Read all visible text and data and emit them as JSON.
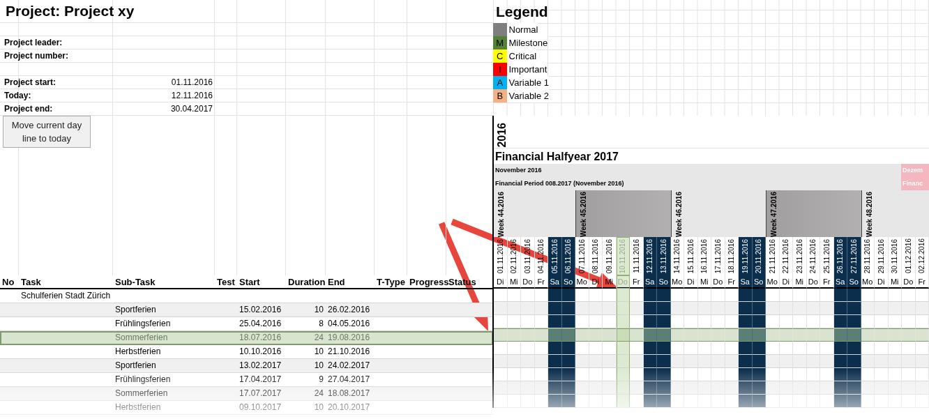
{
  "project": {
    "title": "Project: Project xy",
    "people": [
      "Project leader:",
      "Project number:"
    ],
    "dates": [
      {
        "label": "Project start:",
        "value": "01.11.2016"
      },
      {
        "label": "Today:",
        "value": "12.11.2016"
      },
      {
        "label": "Project end:",
        "value": "30.04.2017"
      }
    ],
    "action_button": "Move current day line to today"
  },
  "legend": {
    "title": "Legend",
    "items": [
      {
        "label": "Normal",
        "color": "#7f7f7f"
      },
      {
        "letter": "M",
        "label": "Milestone",
        "color": "#548235"
      },
      {
        "letter": "C",
        "label": "Critical",
        "color": "#ffff00"
      },
      {
        "letter": "I",
        "label": "Important",
        "color": "#ff0000"
      },
      {
        "letter": "A",
        "label": "Variable 1",
        "color": "#00b0f0"
      },
      {
        "letter": "B",
        "label": "Variable 2",
        "color": "#f4b183"
      }
    ]
  },
  "gantt": {
    "year": "2016",
    "title": "Financial Halfyear 2017",
    "month": "November 2016",
    "period": "Financial Period 008.2017 (November 2016)",
    "next_month": "Dezem",
    "next_period": "Financ",
    "weeks": [
      {
        "label": "Week 44.2016",
        "shaded": false,
        "days": [
          {
            "date": "01.11.2016",
            "weekday": "Di",
            "kind": "workday",
            "selected": false
          },
          {
            "date": "02.11.2016",
            "weekday": "Mi",
            "kind": "workday",
            "selected": false
          },
          {
            "date": "03.11.2016",
            "weekday": "Do",
            "kind": "workday",
            "selected": false
          },
          {
            "date": "04.11.2016",
            "weekday": "Fr",
            "kind": "workday",
            "selected": false
          },
          {
            "date": "05.11.2016",
            "weekday": "Sa",
            "kind": "weekend",
            "selected": false
          },
          {
            "date": "06.11.2016",
            "weekday": "So",
            "kind": "weekend",
            "selected": false
          }
        ]
      },
      {
        "label": "Week 45.2016",
        "shaded": true,
        "days": [
          {
            "date": "07.11.2016",
            "weekday": "Mo",
            "kind": "workday",
            "selected": false
          },
          {
            "date": "08.11.2016",
            "weekday": "Di",
            "kind": "workday",
            "selected": false
          },
          {
            "date": "09.11.2016",
            "weekday": "Mi",
            "kind": "workday",
            "selected": false
          },
          {
            "date": "10.11.2016",
            "weekday": "Do",
            "kind": "workday",
            "selected": true
          },
          {
            "date": "11.11.2016",
            "weekday": "Fr",
            "kind": "workday",
            "selected": false
          },
          {
            "date": "12.11.2016",
            "weekday": "Sa",
            "kind": "weekend",
            "selected": false
          },
          {
            "date": "13.11.2016",
            "weekday": "So",
            "kind": "weekend",
            "selected": false
          }
        ]
      },
      {
        "label": "Week 46.2016",
        "shaded": false,
        "days": [
          {
            "date": "14.11.2016",
            "weekday": "Mo",
            "kind": "workday",
            "selected": false
          },
          {
            "date": "15.11.2016",
            "weekday": "Di",
            "kind": "workday",
            "selected": false
          },
          {
            "date": "16.11.2016",
            "weekday": "Mi",
            "kind": "workday",
            "selected": false
          },
          {
            "date": "17.11.2016",
            "weekday": "Do",
            "kind": "workday",
            "selected": false
          },
          {
            "date": "18.11.2016",
            "weekday": "Fr",
            "kind": "workday",
            "selected": false
          },
          {
            "date": "19.11.2016",
            "weekday": "Sa",
            "kind": "weekend",
            "selected": false
          },
          {
            "date": "20.11.2016",
            "weekday": "So",
            "kind": "weekend",
            "selected": false
          }
        ]
      },
      {
        "label": "Week 47.2016",
        "shaded": true,
        "days": [
          {
            "date": "21.11.2016",
            "weekday": "Mo",
            "kind": "workday",
            "selected": false
          },
          {
            "date": "22.11.2016",
            "weekday": "Di",
            "kind": "workday",
            "selected": false
          },
          {
            "date": "23.11.2016",
            "weekday": "Mi",
            "kind": "workday",
            "selected": false
          },
          {
            "date": "24.11.2016",
            "weekday": "Do",
            "kind": "workday",
            "selected": false
          },
          {
            "date": "25.11.2016",
            "weekday": "Fr",
            "kind": "workday",
            "selected": false
          },
          {
            "date": "26.11.2016",
            "weekday": "Sa",
            "kind": "weekend",
            "selected": false
          },
          {
            "date": "27.11.2016",
            "weekday": "So",
            "kind": "weekend",
            "selected": false
          }
        ]
      },
      {
        "label": "Week 48.2016",
        "shaded": false,
        "days": [
          {
            "date": "28.11.2016",
            "weekday": "Mo",
            "kind": "workday",
            "selected": false
          },
          {
            "date": "29.11.2016",
            "weekday": "Di",
            "kind": "workday",
            "selected": false
          },
          {
            "date": "30.11.2016",
            "weekday": "Mi",
            "kind": "workday",
            "selected": false
          },
          {
            "date": "01.12.2016",
            "weekday": "Do",
            "kind": "workday",
            "selected": false
          },
          {
            "date": "02.12.2016",
            "weekday": "Fr",
            "kind": "workday",
            "selected": false
          }
        ]
      }
    ]
  },
  "table": {
    "columns": [
      "No",
      "Task",
      "Sub-Task",
      "Test",
      "Start",
      "Duration",
      "End",
      "T-Type",
      "Progress",
      "Status"
    ],
    "rows": [
      {
        "kind": "group",
        "task": "Schulferien Stadt Zürich",
        "selected": false
      },
      {
        "kind": "item",
        "subtask": "Sportferien",
        "start": "15.02.2016",
        "duration": "10",
        "end": "26.02.2016",
        "selected": false
      },
      {
        "kind": "item",
        "subtask": "Frühlingsferien",
        "start": "25.04.2016",
        "duration": "8",
        "end": "04.05.2016",
        "selected": false
      },
      {
        "kind": "item",
        "subtask": "Sommerferien",
        "start": "18.07.2016",
        "duration": "24",
        "end": "19.08.2016",
        "selected": true
      },
      {
        "kind": "item",
        "subtask": "Herbstferien",
        "start": "10.10.2016",
        "duration": "10",
        "end": "21.10.2016",
        "selected": false
      },
      {
        "kind": "item",
        "subtask": "Sportferien",
        "start": "13.02.2017",
        "duration": "10",
        "end": "24.02.2017",
        "selected": false
      },
      {
        "kind": "item",
        "subtask": "Frühlingsferien",
        "start": "17.04.2017",
        "duration": "9",
        "end": "27.04.2017",
        "selected": false
      },
      {
        "kind": "item",
        "subtask": "Sommerferien",
        "start": "17.07.2017",
        "duration": "24",
        "end": "18.08.2017",
        "selected": false
      },
      {
        "kind": "item",
        "subtask": "Herbstferien",
        "start": "09.10.2017",
        "duration": "10",
        "end": "20.10.2017",
        "selected": false
      }
    ]
  }
}
